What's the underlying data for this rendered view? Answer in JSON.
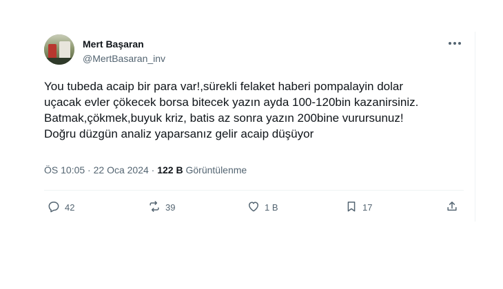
{
  "tweet": {
    "display_name": "Mert Başaran",
    "handle": "@MertBasaran_inv",
    "text": "You tubeda acaip bir para var!,sürekli felaket haberi pompalayin dolar\nuçacak evler çökecek borsa bitecek yazın ayda 100-120bin kazanirsiniz.\nBatmak,çökmek,buyuk kriz, batis az sonra yazın 200bine vurursunuz!\nDoğru düzgün analiz yaparsanız gelir acaip düşüyor",
    "time": "ÖS 10:05",
    "separator": "·",
    "date": "22 Oca 2024",
    "views_count": "122 B",
    "views_label": "Görüntülenme"
  },
  "actions": {
    "replies": "42",
    "reposts": "39",
    "likes": "1 B",
    "bookmarks": "17"
  },
  "icons": [
    "more-icon",
    "reply-icon",
    "repost-icon",
    "like-icon",
    "bookmark-icon",
    "share-icon"
  ],
  "colors": {
    "text": "#0f1419",
    "secondary": "#536471",
    "divider": "#eff3f4"
  }
}
